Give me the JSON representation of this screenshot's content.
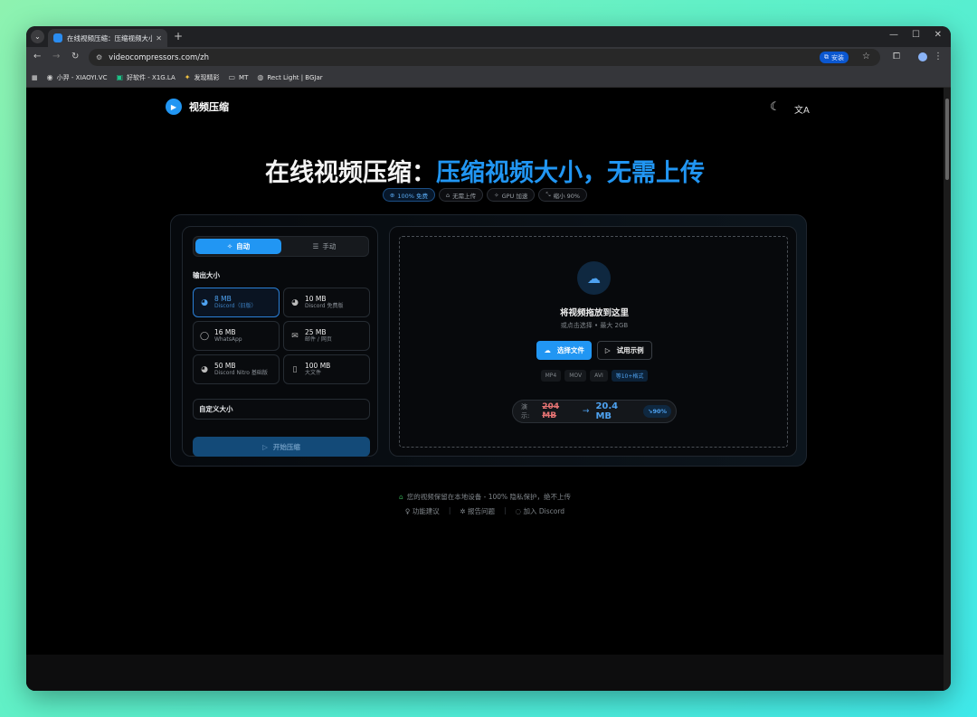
{
  "browser": {
    "tab_title": "在线视频压缩：压缩视频大小、",
    "url": "videocompressors.com/zh",
    "install_label": "安装",
    "bookmarks": [
      {
        "icon": "github-icon",
        "label": "小羿 - XIAOYI.VC"
      },
      {
        "icon": "app-icon",
        "label": "好软件 - X1G.LA"
      },
      {
        "icon": "sparkle-icon",
        "label": "发现精彩"
      },
      {
        "icon": "folder-icon",
        "label": "MT"
      },
      {
        "icon": "globe-icon",
        "label": "Rect Light | BGJar"
      }
    ]
  },
  "header": {
    "brand_name": "视频压缩",
    "theme_icon": "moon-icon",
    "lang_icon": "translate-icon"
  },
  "hero": {
    "title_white": "在线视频压缩：",
    "title_blue": "压缩视频大小，无需上传"
  },
  "badges": [
    {
      "icon": "⊕",
      "label": "100% 免费",
      "active": true
    },
    {
      "icon": "🔒︎",
      "label": "无需上传",
      "active": false
    },
    {
      "icon": "✧",
      "label": "GPU 加速",
      "active": false
    },
    {
      "icon": "⤡",
      "label": "缩小 90%",
      "active": false
    }
  ],
  "settings": {
    "mode_auto": "自动",
    "mode_manual": "手动",
    "output_label": "输出大小",
    "sizes": [
      {
        "icon": "discord-icon",
        "size": "8 MB",
        "desc": "Discord（旧版）",
        "selected": true
      },
      {
        "icon": "discord-icon",
        "size": "10 MB",
        "desc": "Discord 免费版",
        "selected": false
      },
      {
        "icon": "whatsapp-icon",
        "size": "16 MB",
        "desc": "WhatsApp",
        "selected": false
      },
      {
        "icon": "mail-icon",
        "size": "25 MB",
        "desc": "邮件 / 网页",
        "selected": false
      },
      {
        "icon": "discord-icon",
        "size": "50 MB",
        "desc": "Discord Nitro 基础版",
        "selected": false
      },
      {
        "icon": "file-icon",
        "size": "100 MB",
        "desc": "大文件",
        "selected": false
      }
    ],
    "custom_label": "自定义大小",
    "start_label": "开始压缩"
  },
  "dropzone": {
    "title": "将视频拖放到这里",
    "subtitle": "或点击选择 • 最大 2GB",
    "choose_label": "选择文件",
    "sample_label": "试用示例",
    "formats": [
      "MP4",
      "MOV",
      "AVI",
      "等10+格式"
    ],
    "demo_label": "演示:",
    "demo_before": "204 MB",
    "demo_after": "20.4 MB",
    "demo_pct": "90%"
  },
  "footer": {
    "privacy": "您的视频保留在本地设备 - 100% 隐私保护，绝不上传",
    "links": [
      "功能建议",
      "报告问题",
      "加入 Discord"
    ]
  },
  "colors": {
    "accent": "#2196f3",
    "background": "#000000"
  }
}
